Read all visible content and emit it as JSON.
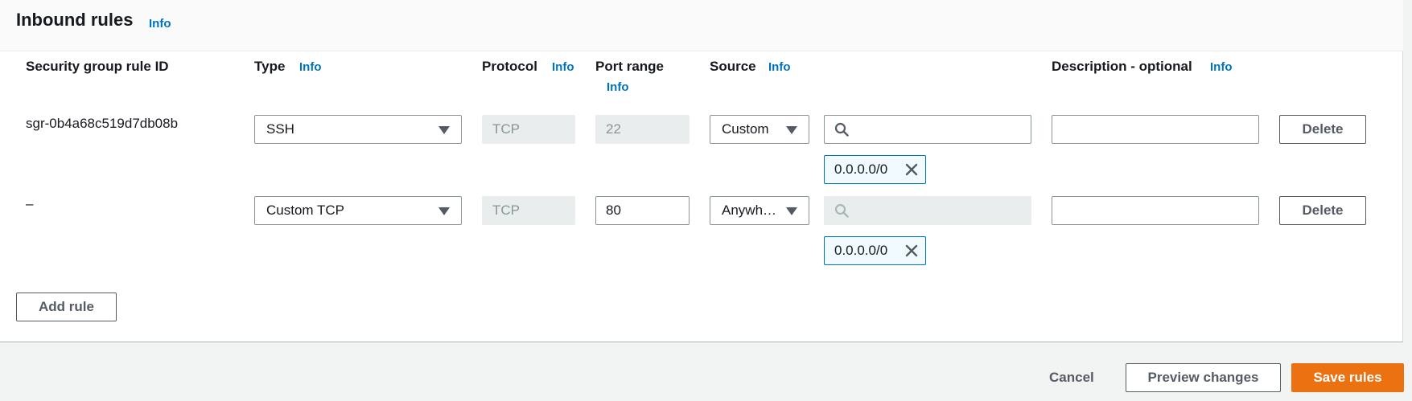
{
  "section": {
    "title": "Inbound rules",
    "info_label": "Info"
  },
  "columns": {
    "rule_id": "Security group rule ID",
    "type": "Type",
    "protocol": "Protocol",
    "port_range": "Port range",
    "source": "Source",
    "description": "Description - optional"
  },
  "rules": [
    {
      "id": "sgr-0b4a68c519d7db08b",
      "type": "SSH",
      "protocol": "TCP",
      "port": "22",
      "source": "Custom",
      "search_value": "",
      "cidr_token": "0.0.0.0/0",
      "description": "",
      "delete_label": "Delete"
    },
    {
      "id": "–",
      "type": "Custom TCP",
      "protocol": "TCP",
      "port": "80",
      "source": "Anywh…",
      "search_value": "",
      "cidr_token": "0.0.0.0/0",
      "description": "",
      "delete_label": "Delete"
    }
  ],
  "actions": {
    "add_rule": "Add rule",
    "cancel": "Cancel",
    "preview": "Preview changes",
    "save": "Save rules"
  },
  "colors": {
    "accent": "#ec7211",
    "link": "#0073bb"
  },
  "icons": {
    "dropdown": "caret-down-icon",
    "search": "search-icon",
    "remove": "close-icon"
  }
}
